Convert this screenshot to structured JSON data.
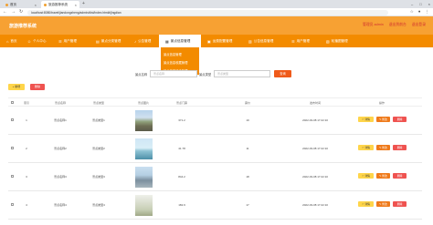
{
  "browser": {
    "tabs": [
      {
        "title": "首页",
        "active": false
      },
      {
        "title": "旅游推荐系统",
        "active": true
      }
    ],
    "url": "localhost:8080/travel/jiandongzheng/admin/dist/index.html#/jingdian"
  },
  "header": {
    "site_title": "旅游推荐系统",
    "links": [
      "管理员 admin",
      "退出到前台",
      "退出登录"
    ]
  },
  "nav": {
    "items": [
      {
        "label": "首页",
        "icon": "home-icon"
      },
      {
        "label": "个人中心",
        "icon": "user-icon"
      },
      {
        "label": "用户管理",
        "icon": "users-icon"
      },
      {
        "label": "景点分类管理",
        "icon": "folder-icon"
      },
      {
        "label": "公告管理",
        "icon": "bell-icon"
      },
      {
        "label": "景点信息管理",
        "icon": "map-icon",
        "active": true
      },
      {
        "label": "运费配置管理",
        "icon": "truck-icon"
      },
      {
        "label": "公告信息管理",
        "icon": "news-icon"
      },
      {
        "label": "用户管理",
        "icon": "users-icon"
      },
      {
        "label": "轮播图管理",
        "icon": "image-icon"
      }
    ],
    "dropdown": [
      "景点信息管理",
      "景点信息收藏管理",
      "景点信息评论管理"
    ]
  },
  "search": {
    "name_label": "景点名称",
    "name_placeholder": "景点名称",
    "type_label": "景点类型",
    "type_placeholder": "景点类型",
    "query_button": "查询"
  },
  "toolbar": {
    "add": "+ 新增",
    "delete": "删除"
  },
  "table": {
    "headers": [
      "索引",
      "景点名称",
      "景点类型",
      "景点图片",
      "景点门票",
      "票价",
      "发布时间",
      "操作"
    ],
    "rows": [
      {
        "index": "1",
        "name": "景点名称1",
        "type": "景点类型1",
        "ticket": "371.2",
        "views": "19",
        "time": "2022-03-08 17:22:10"
      },
      {
        "index": "2",
        "name": "景点名称2",
        "type": "景点类型2",
        "ticket": "41.78",
        "views": "11",
        "time": "2022-03-08 17:22:10"
      },
      {
        "index": "3",
        "name": "景点名称3",
        "type": "景点类型3",
        "ticket": "844.2",
        "views": "18",
        "time": "2022-03-08 17:22:10"
      },
      {
        "index": "4",
        "name": "景点名称4",
        "type": "景点类型4",
        "ticket": "182.9",
        "views": "17",
        "time": "2022-03-08 17:22:10"
      }
    ],
    "actions": {
      "detail": "☆ 详情",
      "edit": "✎ 修改",
      "remove": "删除"
    }
  },
  "colors": {
    "header": "#f7a133",
    "nav": "#f38b00",
    "query": "#ef5a1a",
    "delete": "#ef5350",
    "add": "#ffd54a"
  }
}
